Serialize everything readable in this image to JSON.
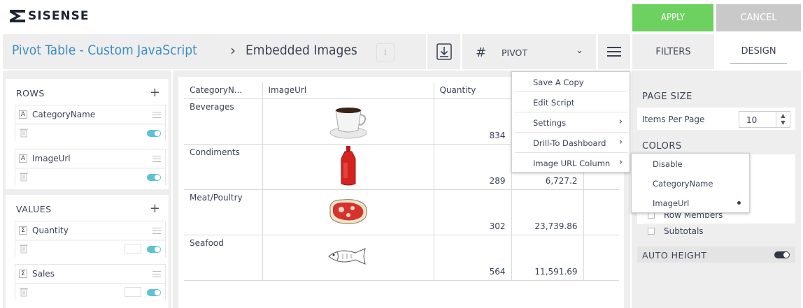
{
  "brand": {
    "logo_text": "SISENSE"
  },
  "actions": {
    "apply_label": "APPLY",
    "cancel_label": "CANCEL"
  },
  "breadcrumb": {
    "parent": "Pivot Table - Custom JavaScript",
    "separator": "›",
    "current": "Embedded Images",
    "info_glyph": "i"
  },
  "toolbar": {
    "widget_type": "PIVOT",
    "export_icon": "download-icon",
    "menu_icon": "hamburger-icon"
  },
  "tabs": {
    "filters": "FILTERS",
    "design": "DESIGN"
  },
  "left_panel": {
    "rows_title": "ROWS",
    "rows": [
      {
        "type": "A",
        "name": "CategoryName"
      },
      {
        "type": "A",
        "name": "ImageUrl"
      }
    ],
    "values_title": "VALUES",
    "values": [
      {
        "type": "Σ",
        "name": "Quantity"
      },
      {
        "type": "Σ",
        "name": "Sales"
      }
    ]
  },
  "table": {
    "headers": [
      "CategoryN...",
      "ImageUrl",
      "Quantity",
      ""
    ],
    "rows": [
      {
        "category": "Beverages",
        "image": "coffee-cup-image",
        "quantity": "834",
        "sales": ""
      },
      {
        "category": "Condiments",
        "image": "ketchup-bottle-image",
        "quantity": "289",
        "sales": "6,727.2"
      },
      {
        "category": "Meat/Poultry",
        "image": "steak-image",
        "quantity": "302",
        "sales": "23,739.86"
      },
      {
        "category": "Seafood",
        "image": "fish-image",
        "quantity": "564",
        "sales": "11,591.69"
      }
    ]
  },
  "context_menu": {
    "items": [
      {
        "label": "Save A Copy",
        "has_submenu": false
      },
      {
        "label": "Edit Script",
        "has_submenu": false
      },
      {
        "label": "Settings",
        "has_submenu": true
      },
      {
        "label": "Drill-To Dashboard",
        "has_submenu": true
      },
      {
        "label": "Image URL Column",
        "has_submenu": true
      }
    ],
    "arrow": "›"
  },
  "submenu": {
    "items": [
      {
        "label": "Disable",
        "selected": false
      },
      {
        "label": "CategoryName",
        "selected": false
      },
      {
        "label": "ImageUrl",
        "selected": true
      }
    ]
  },
  "design_panel": {
    "page_size_title": "PAGE SIZE",
    "items_per_page_label": "Items Per Page",
    "items_per_page_value": "10",
    "colors_title": "COLORS",
    "color_options": [
      "Row Members",
      "Subtotals"
    ],
    "auto_height_label": "AUTO HEIGHT"
  },
  "colors": {
    "accent_green": "#6cd15f",
    "link_blue": "#3a8ec1",
    "toggle_teal": "#5cc2d4"
  }
}
